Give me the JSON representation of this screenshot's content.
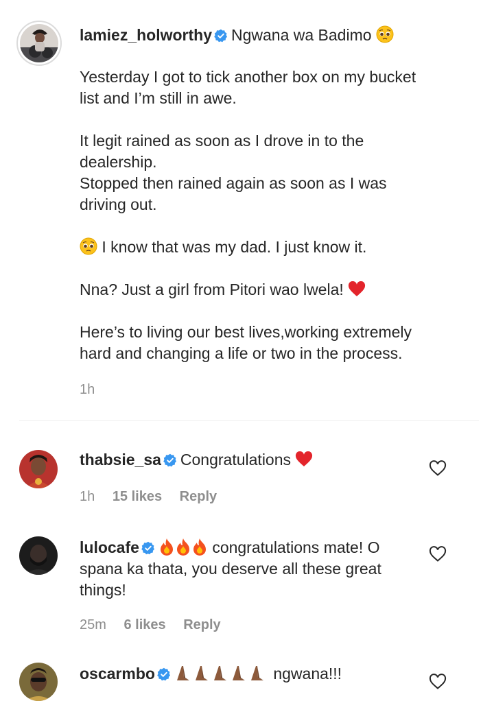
{
  "caption": {
    "username": "lamiez_holworthy",
    "headline": "Ngwana wa Badimo",
    "paragraphs": [
      [
        "Yesterday I got to tick another box on my bucket",
        "list and I’m still in awe."
      ],
      [
        "It legit rained as soon as I drove in to the",
        "dealership.",
        "Stopped then rained again as soon as I was",
        "driving out."
      ],
      [
        "I know that was my dad. I just know it."
      ],
      [
        "Nna? Just a girl from Pitori wao lwela!"
      ],
      [
        "Here’s to living our best lives,working extremely",
        "hard and changing a life or two in the process."
      ]
    ],
    "time": "1h"
  },
  "comments": [
    {
      "username": "thabsie_sa",
      "lines": [
        "Congratulations"
      ],
      "time": "1h",
      "likes": "15 likes",
      "reply": "Reply"
    },
    {
      "username": "lulocafe",
      "lines": [
        "congratulations mate! O",
        "spana ka thata, you deserve all these great",
        "things!"
      ],
      "time": "25m",
      "likes": "6 likes",
      "reply": "Reply"
    },
    {
      "username": "oscarmbo",
      "lines": [
        "ngwana!!!"
      ]
    }
  ],
  "colors": {
    "verified": "#3897f0",
    "heart": "#ed4956",
    "muted": "#8e8e8e",
    "text": "#262626"
  },
  "icons": {
    "verified": "verified-badge-icon",
    "pleading": "pleading-face-emoji",
    "heart": "red-heart-emoji",
    "fire": "fire-emoji",
    "pray": "folded-hands-emoji",
    "like": "heart-outline-icon"
  }
}
